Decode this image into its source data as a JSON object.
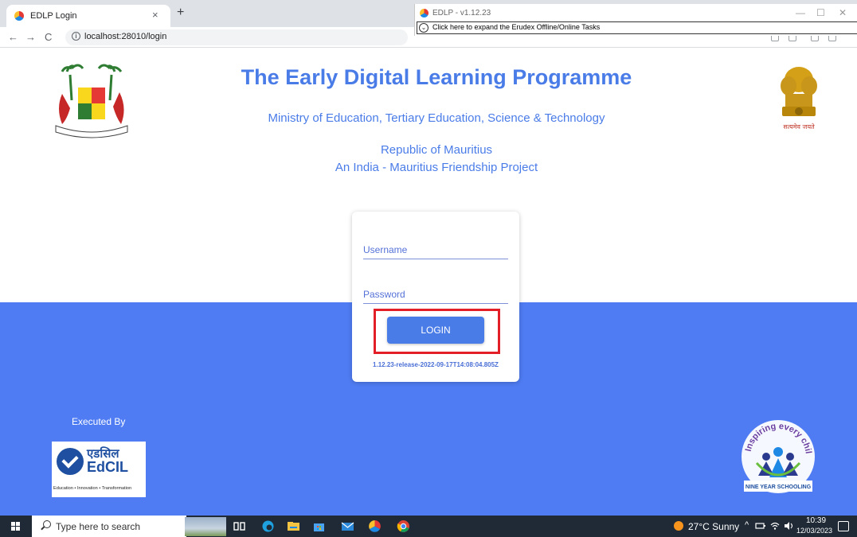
{
  "browser": {
    "tab_title": "EDLP Login",
    "tab_close": "×",
    "new_tab": "+",
    "url": "localhost:28010/login",
    "back": "←",
    "forward": "→",
    "reload": "C"
  },
  "overlay": {
    "title": "EDLP - v1.12.23",
    "minimize": "—",
    "maximize": "☐",
    "close": "✕",
    "expand_text": "Click here to expand the Erudex Offline/Online Tasks",
    "expand_icon": "chevron-down-icon"
  },
  "page": {
    "heading": "The Early Digital Learning Programme",
    "ministry": "Ministry of Education, Tertiary Education, Science & Technology",
    "republic": "Republic of Mauritius",
    "friendship": "An India - Mauritius Friendship Project",
    "emblem_right_caption": "सत्यमेव जयते"
  },
  "login": {
    "username_placeholder": "Username",
    "password_placeholder": "Password",
    "login_label": "LOGIN",
    "version": "1.12.23-release-2022-09-17T14:08:04.805Z",
    "highlight_color": "#e21f26"
  },
  "footer": {
    "executed_by": "Executed By",
    "edcil_hindi": "एडसिल",
    "edcil_name": "EdCIL",
    "edcil_tagline": "Education • Innovation • Transformation",
    "nys_top": "Inspiring every child",
    "nys_bottom": "NINE YEAR SCHOOLING"
  },
  "taskbar": {
    "search_placeholder": "Type here to search",
    "weather": "27°C  Sunny",
    "time": "10:39",
    "date": "12/03/2023"
  },
  "colors": {
    "accent": "#4a7ce8",
    "band": "#4f7cf3",
    "taskbar": "#1f2a36"
  }
}
